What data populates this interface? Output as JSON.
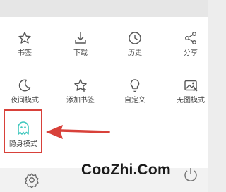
{
  "menu": {
    "items": [
      {
        "label": "书签",
        "icon": "star-icon"
      },
      {
        "label": "下载",
        "icon": "download-icon"
      },
      {
        "label": "历史",
        "icon": "clock-icon"
      },
      {
        "label": "分享",
        "icon": "share-icon"
      },
      {
        "label": "夜间模式",
        "icon": "moon-icon"
      },
      {
        "label": "添加书签",
        "icon": "star-plus-icon"
      },
      {
        "label": "自定义",
        "icon": "lightbulb-icon"
      },
      {
        "label": "无图模式",
        "icon": "image-icon"
      },
      {
        "label": "隐身模式",
        "icon": "ghost-icon"
      }
    ]
  },
  "annotation": {
    "highlight_color": "#d8413a"
  },
  "watermark": {
    "text": "CooZhi.Com"
  },
  "bottombar": {
    "icons": [
      "gear-icon"
    ]
  },
  "colors": {
    "icon": "#555555",
    "incognito_accent": "#3ec7bd",
    "panel": "#ffffff",
    "background": "#ededed"
  }
}
